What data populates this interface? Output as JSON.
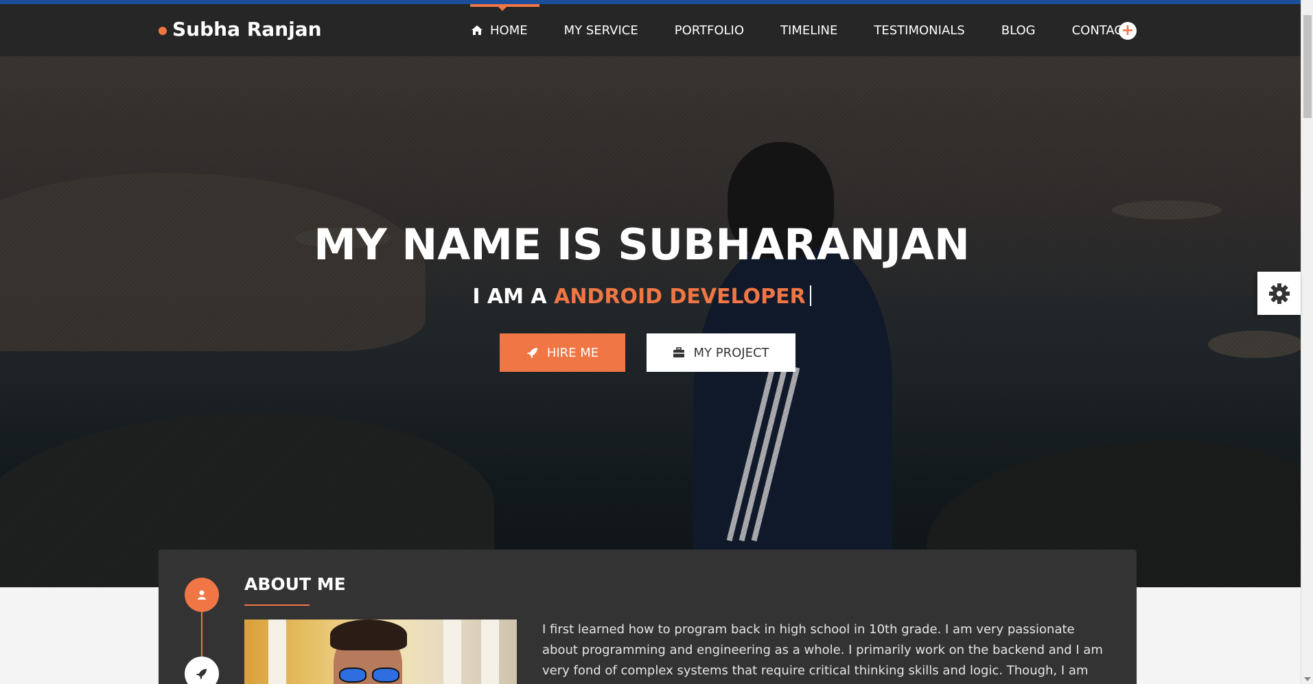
{
  "brand": {
    "name": "Subha Ranjan"
  },
  "nav": {
    "items": [
      {
        "label": "HOME",
        "active": true
      },
      {
        "label": "MY SERVICE"
      },
      {
        "label": "PORTFOLIO"
      },
      {
        "label": "TIMELINE"
      },
      {
        "label": "TESTIMONIALS"
      },
      {
        "label": "BLOG"
      },
      {
        "label": "CONTACT"
      }
    ],
    "plus_symbol": "+"
  },
  "hero": {
    "title": "MY NAME IS SUBHARANJAN",
    "subtitle_prefix": "I AM A",
    "subtitle_role": "ANDROID DEVELOPER",
    "buttons": {
      "hire": "HIRE ME",
      "project": "MY PROJECT"
    }
  },
  "about": {
    "title": "ABOUT ME",
    "text": "I first learned how to program back in high school in 10th grade. I am very passionate about programming and engineering as a whole. I primarily work on the backend and I am very fond of complex systems that require critical thinking skills and logic. Though, I am flexible and have worked"
  },
  "icons": [
    "home-icon",
    "plus-icon",
    "rocket-icon",
    "briefcase-icon",
    "gear-icon",
    "user-icon"
  ],
  "colors": {
    "accent": "#f07646",
    "navbar": "#262626",
    "top_strip": "#1d4e9a",
    "about_bg": "#333333"
  }
}
